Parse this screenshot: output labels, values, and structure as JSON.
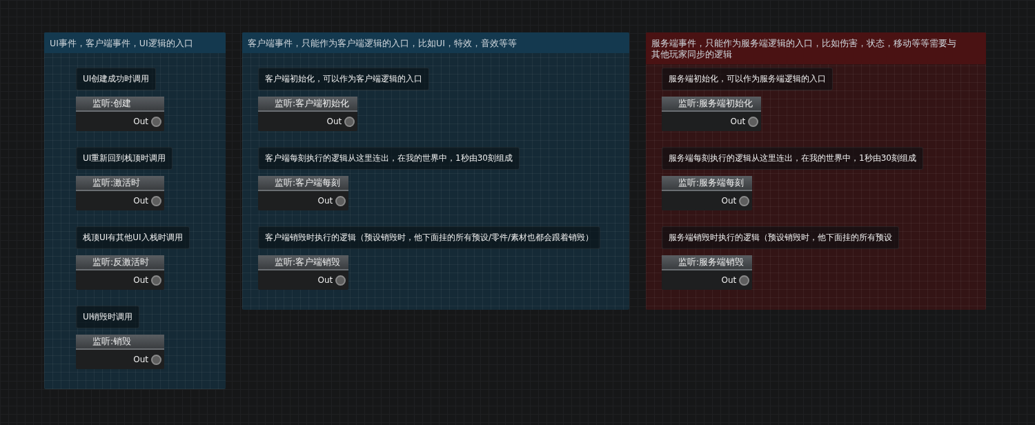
{
  "groups": [
    {
      "title": "UI事件，客户端事件，UI逻辑的入口",
      "color": "#14394f",
      "nodes": [
        {
          "comment": "UI创建成功时调用",
          "label": "监听:创建",
          "port": "Out"
        },
        {
          "comment": "UI重新回到栈顶时调用",
          "label": "监听:激活时",
          "port": "Out"
        },
        {
          "comment": "栈顶UI有其他UI入栈时调用",
          "label": "监听:反激活时",
          "port": "Out"
        },
        {
          "comment": "UI销毁时调用",
          "label": "监听:销毁",
          "port": "Out"
        }
      ]
    },
    {
      "title": "客户端事件，只能作为客户端逻辑的入口，比如UI，特效，音效等等",
      "color": "#14394f",
      "nodes": [
        {
          "comment": "客户端初始化，可以作为客户端逻辑的入口",
          "label": "监听:客户端初始化",
          "port": "Out"
        },
        {
          "comment": "客户端每刻执行的逻辑从这里连出，在我的世界中，1秒由30刻组成",
          "label": "监听:客户端每刻",
          "port": "Out"
        },
        {
          "comment": "客户端销毁时执行的逻辑（预设销毁时，他下面挂的所有预设/零件/素材也都会跟着销毁）",
          "label": "监听:客户端销毁",
          "port": "Out"
        }
      ]
    },
    {
      "title": "服务端事件，只能作为服务端逻辑的入口，比如伤害，状态，移动等等需要与其他玩家同步的逻辑",
      "color": "#4a1213",
      "nodes": [
        {
          "comment": "服务端初始化，可以作为服务端逻辑的入口",
          "label": "监听:服务端初始化",
          "port": "Out"
        },
        {
          "comment": "服务端每刻执行的逻辑从这里连出，在我的世界中，1秒由30刻组成",
          "label": "监听:服务端每刻",
          "port": "Out"
        },
        {
          "comment": "服务端销毁时执行的逻辑（预设销毁时，他下面挂的所有预设",
          "label": "监听:服务端销毁",
          "port": "Out"
        }
      ]
    }
  ]
}
